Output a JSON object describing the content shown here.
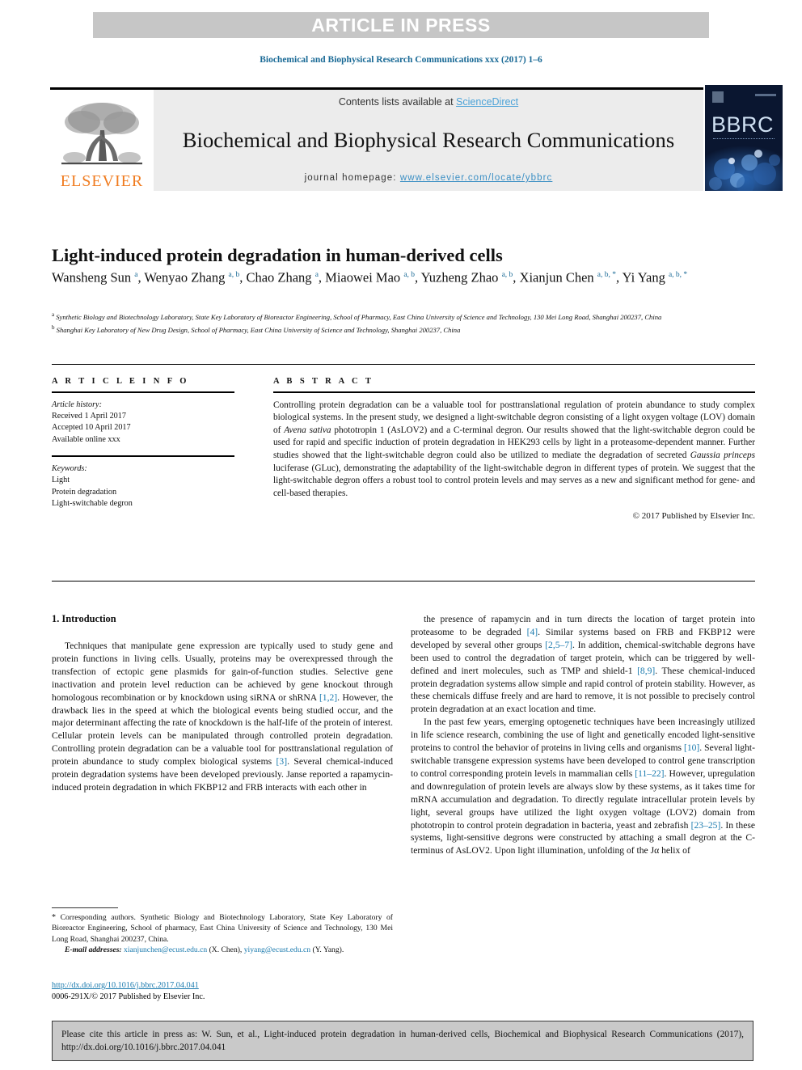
{
  "banner": {
    "label": "ARTICLE IN PRESS"
  },
  "running_head": "Biochemical and Biophysical Research Communications xxx (2017) 1–6",
  "masthead": {
    "contents_prefix": "Contents lists available at ",
    "sciencedirect": "ScienceDirect",
    "journal_title": "Biochemical and Biophysical Research Communications",
    "homepage_prefix": "journal homepage: ",
    "homepage_url": "www.elsevier.com/locate/ybbrc",
    "publisher_logo_text": "ELSEVIER",
    "cover_logo_text": "BBRC",
    "logo_icon": "elsevier-tree-logo"
  },
  "article": {
    "title": "Light-induced protein degradation in human-derived cells",
    "authors_html": "Wansheng Sun <sup>a</sup>, Wenyao Zhang <sup>a, b</sup>, Chao Zhang <sup>a</sup>, Miaowei Mao <sup>a, b</sup>, Yuzheng Zhao <sup>a, b</sup>, Xianjun Chen <sup>a, b, *</sup>, Yi Yang <sup>a, b, *</sup>",
    "affiliations_html": "<sup>a</sup> Synthetic Biology and Biotechnology Laboratory, State Key Laboratory of Bioreactor Engineering, School of Pharmacy, East China University of Science and Technology, 130 Mei Long Road, Shanghai 200237, China<br><sup>b</sup> Shanghai Key Laboratory of New Drug Design, School of Pharmacy, East China University of Science and Technology, Shanghai 200237, China"
  },
  "article_info": {
    "heading": "A R T I C L E    I N F O",
    "history_label": "Article history:",
    "received": "Received 1 April 2017",
    "accepted": "Accepted 10 April 2017",
    "available": "Available online xxx",
    "keywords_label": "Keywords:",
    "keywords": [
      "Light",
      "Protein degradation",
      "Light-switchable degron"
    ]
  },
  "abstract": {
    "heading": "A B S T R A C T",
    "body_html": "Controlling protein degradation can be a valuable tool for posttranslational regulation of protein abundance to study complex biological systems. In the present study, we designed a light-switchable degron consisting of a light oxygen voltage (LOV) domain of <span class=\"it\">Avena sativa</span> phototropin 1 (AsLOV2) and a C-terminal degron. Our results showed that the light-switchable degron could be used for rapid and specific induction of protein degradation in HEK293 cells by light in a proteasome-dependent manner. Further studies showed that the light-switchable degron could also be utilized to mediate the degradation of secreted <span class=\"it\">Gaussia princeps</span> luciferase (GLuc), demonstrating the adaptability of the light-switchable degron in different types of protein. We suggest that the light-switchable degron offers a robust tool to control protein levels and may serves as a new and significant method for gene- and cell-based therapies.",
    "copyright": "© 2017 Published by Elsevier Inc."
  },
  "body": {
    "section_heading": "1.  Introduction",
    "left_paragraphs_html": [
      "Techniques that manipulate gene expression are typically used to study gene and protein functions in living cells. Usually, proteins may be overexpressed through the transfection of ectopic gene plasmids for gain-of-function studies. Selective gene inactivation and protein level reduction can be achieved by gene knockout through homologous recombination or by knockdown using siRNA or shRNA <span class=\"ref\">[1,2]</span>. However, the drawback lies in the speed at which the biological events being studied occur, and the major determinant affecting the rate of knockdown is the half-life of the protein of interest. Cellular protein levels can be manipulated through controlled protein degradation. Controlling protein degradation can be a valuable tool for posttranslational regulation of protein abundance to study complex biological systems <span class=\"ref\">[3]</span>. Several chemical-induced protein degradation systems have been developed previously. Janse reported a rapamycin-induced protein degradation in which FKBP12 and FRB interacts with each other in"
    ],
    "right_paragraphs_html": [
      "the presence of rapamycin and in turn directs the location of target protein into proteasome to be degraded <span class=\"ref\">[4]</span>. Similar systems based on FRB and FKBP12 were developed by several other groups <span class=\"ref\">[2,5–7]</span>. In addition, chemical-switchable degrons have been used to control the degradation of target protein, which can be triggered by well-defined and inert molecules, such as TMP and shield-1 <span class=\"ref\">[8,9]</span>. These chemical-induced protein degradation systems allow simple and rapid control of protein stability. However, as these chemicals diffuse freely and are hard to remove, it is not possible to precisely control protein degradation at an exact location and time.",
      "In the past few years, emerging optogenetic techniques have been increasingly utilized in life science research, combining the use of light and genetically encoded light-sensitive proteins to control the behavior of proteins in living cells and organisms <span class=\"ref\">[10]</span>. Several light-switchable transgene expression systems have been developed to control gene transcription to control corresponding protein levels in mammalian cells <span class=\"ref\">[11–22]</span>. However, upregulation and downregulation of protein levels are always slow by these systems, as it takes time for mRNA accumulation and degradation. To directly regulate intracellular protein levels by light, several groups have utilized the light oxygen voltage (LOV2) domain from phototropin to control protein degradation in bacteria, yeast and zebrafish <span class=\"ref\">[23–25]</span>. In these systems, light-sensitive degrons were constructed by attaching a small degron at the C-terminus of AsLOV2. Upon light illumination, unfolding of the Jα helix of"
    ]
  },
  "footnote": {
    "body_html": "<span class=\"star\">*</span> Corresponding authors. Synthetic Biology and Biotechnology Laboratory, State Key Laboratory of Bioreactor Engineering, School of pharmacy, East China University of Science and Technology, 130 Mei Long Road, Shanghai 200237, China.",
    "emails_html": "<span class=\"lbl\">E-mail addresses:</span> <span class=\"mail\">xianjunchen@ecust.edu.cn</span> (X. Chen), <span class=\"mail\">yiyang@ecust.edu.cn</span> (Y. Yang).",
    "doi": "http://dx.doi.org/10.1016/j.bbrc.2017.04.041",
    "issn_line": "0006-291X/© 2017 Published by Elsevier Inc."
  },
  "cite_box": {
    "text": "Please cite this article in press as: W. Sun, et al., Light-induced protein degradation in human-derived cells, Biochemical and Biophysical Research Communications (2017), http://dx.doi.org/10.1016/j.bbrc.2017.04.041"
  },
  "colors": {
    "banner_bg": "#c6c6c6",
    "link_blue": "#1a7aae",
    "sciencedirect_blue": "#4ca3d8",
    "elsevier_orange": "#f07c20",
    "masthead_bg": "#ececec",
    "cover_navy": "#0a1630",
    "cite_bg": "#c9c9c9"
  }
}
